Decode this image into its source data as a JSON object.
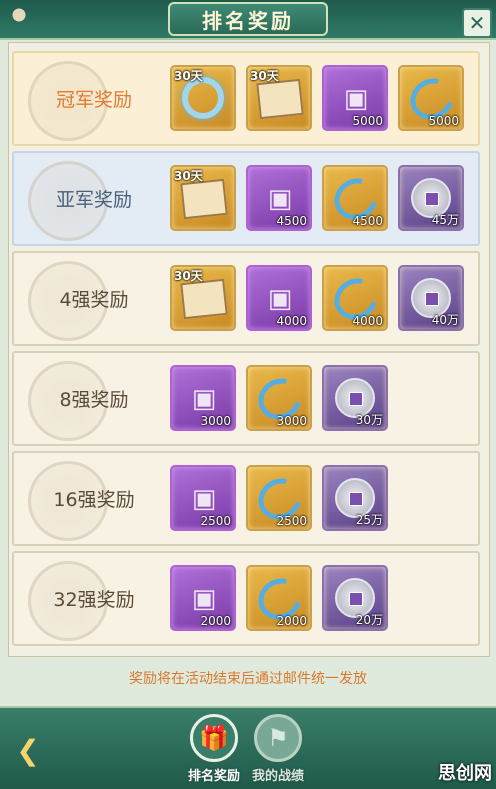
{
  "title": "排名奖励",
  "close_label": "✕",
  "rows": [
    {
      "label": "冠军奖励",
      "items": [
        {
          "kind": "wreath",
          "style": "gold",
          "tag": "30天",
          "qty": ""
        },
        {
          "kind": "scroll",
          "style": "gold",
          "tag": "30天",
          "qty": ""
        },
        {
          "kind": "box",
          "style": "purple",
          "tag": "",
          "qty": "5000"
        },
        {
          "kind": "swirl",
          "style": "gold",
          "tag": "",
          "qty": "5000"
        }
      ]
    },
    {
      "label": "亚军奖励",
      "items": [
        {
          "kind": "scroll",
          "style": "gold",
          "tag": "30天",
          "qty": ""
        },
        {
          "kind": "box",
          "style": "purple",
          "tag": "",
          "qty": "4500"
        },
        {
          "kind": "swirl",
          "style": "gold",
          "tag": "",
          "qty": "4500"
        },
        {
          "kind": "coin",
          "style": "silver",
          "tag": "",
          "qty": "45万"
        }
      ]
    },
    {
      "label": "4强奖励",
      "items": [
        {
          "kind": "scroll",
          "style": "gold",
          "tag": "30天",
          "qty": ""
        },
        {
          "kind": "box",
          "style": "purple",
          "tag": "",
          "qty": "4000"
        },
        {
          "kind": "swirl",
          "style": "gold",
          "tag": "",
          "qty": "4000"
        },
        {
          "kind": "coin",
          "style": "silver",
          "tag": "",
          "qty": "40万"
        }
      ]
    },
    {
      "label": "8强奖励",
      "items": [
        {
          "kind": "box",
          "style": "purple",
          "tag": "",
          "qty": "3000"
        },
        {
          "kind": "swirl",
          "style": "gold",
          "tag": "",
          "qty": "3000"
        },
        {
          "kind": "coin",
          "style": "silver",
          "tag": "",
          "qty": "30万"
        }
      ]
    },
    {
      "label": "16强奖励",
      "items": [
        {
          "kind": "box",
          "style": "purple",
          "tag": "",
          "qty": "2500"
        },
        {
          "kind": "swirl",
          "style": "gold",
          "tag": "",
          "qty": "2500"
        },
        {
          "kind": "coin",
          "style": "silver",
          "tag": "",
          "qty": "25万"
        }
      ]
    },
    {
      "label": "32强奖励",
      "items": [
        {
          "kind": "box",
          "style": "purple",
          "tag": "",
          "qty": "2000"
        },
        {
          "kind": "swirl",
          "style": "gold",
          "tag": "",
          "qty": "2000"
        },
        {
          "kind": "coin",
          "style": "silver",
          "tag": "",
          "qty": "20万"
        }
      ]
    }
  ],
  "note": "奖励将在活动结束后通过邮件统一发放",
  "tabs": [
    {
      "label": "排名奖励",
      "active": true,
      "icon": "gift-icon"
    },
    {
      "label": "我的战绩",
      "active": false,
      "icon": "trophy-icon"
    }
  ],
  "watermark": "思创网",
  "colors": {
    "accent": "#e07b33",
    "note": "#d9792f",
    "frame": "#2f6f5f"
  }
}
